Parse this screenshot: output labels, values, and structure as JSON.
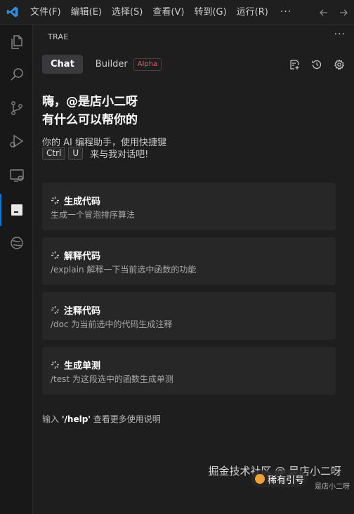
{
  "menu": {
    "items": [
      "文件(F)",
      "编辑(E)",
      "选择(S)",
      "查看(V)",
      "转到(G)",
      "运行(R)"
    ],
    "more": "···"
  },
  "panel": {
    "title": "TRAE",
    "more": "···",
    "tabs": {
      "chat": "Chat",
      "builder": "Builder",
      "builder_badge": "Alpha"
    }
  },
  "welcome": {
    "line1": "嗨，@是店小二呀",
    "line2": "有什么可以帮你的",
    "intro": "你的 AI 编程助手，使用快捷键",
    "keys": [
      "Ctrl",
      "U"
    ],
    "shortcut_text": "来与我对话吧!"
  },
  "cards": [
    {
      "title": "生成代码",
      "desc": "生成一个冒泡排序算法"
    },
    {
      "title": "解释代码",
      "desc": "/explain 解释一下当前选中函数的功能"
    },
    {
      "title": "注释代码",
      "desc": "/doc 为当前选中的代码生成注释"
    },
    {
      "title": "生成单测",
      "desc": "/test 为这段选中的函数生成单测"
    }
  ],
  "help": {
    "prefix": "输入",
    "command": "'/help'",
    "suffix": "查看更多使用说明"
  },
  "watermark": {
    "text": "掘金技术社区 @ 是店小二呀",
    "badge": "稀有引号",
    "small": "是店小二呀"
  },
  "colors": {
    "accent": "#0078d4",
    "badge": "#e06070",
    "background": "#1e1e1e",
    "activitybar": "#181818",
    "card": "#272727"
  },
  "icons": {
    "activity": [
      "explorer-icon",
      "search-icon",
      "source-control-icon",
      "run-debug-icon",
      "remote-explorer-icon",
      "trae-chat-icon",
      "extension-icon"
    ],
    "tools": [
      "new-chat-icon",
      "history-icon",
      "settings-icon"
    ]
  }
}
